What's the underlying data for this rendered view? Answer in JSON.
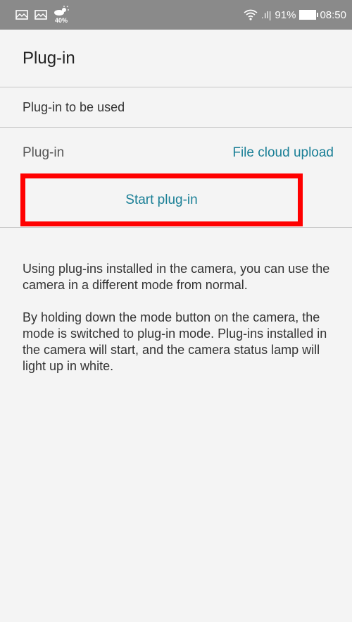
{
  "status_bar": {
    "weather_percent": "40%",
    "signal_text": ".ıl|",
    "battery": "91%",
    "time": "08:50",
    "icons": [
      "mail-icon",
      "mail-icon",
      "weather-icon",
      "wifi-icon",
      "signal-icon",
      "battery-icon"
    ]
  },
  "header": {
    "title": "Plug-in"
  },
  "section": {
    "title": "Plug-in to be used"
  },
  "plugin_row": {
    "label": "Plug-in",
    "value": "File cloud upload"
  },
  "start_button": {
    "label": "Start plug-in"
  },
  "description": {
    "paragraph1": "Using plug-ins installed in the camera, you can use the camera in a different mode from normal.",
    "paragraph2": "By holding down the mode button on the camera, the mode is switched to plug-in mode. Plug-ins installed in the camera will start, and the camera status lamp will light up in white."
  },
  "colors": {
    "accent": "#1a7f96",
    "highlight": "#ff0000",
    "status_bar": "#8a8a8a",
    "background": "#f4f4f4"
  }
}
